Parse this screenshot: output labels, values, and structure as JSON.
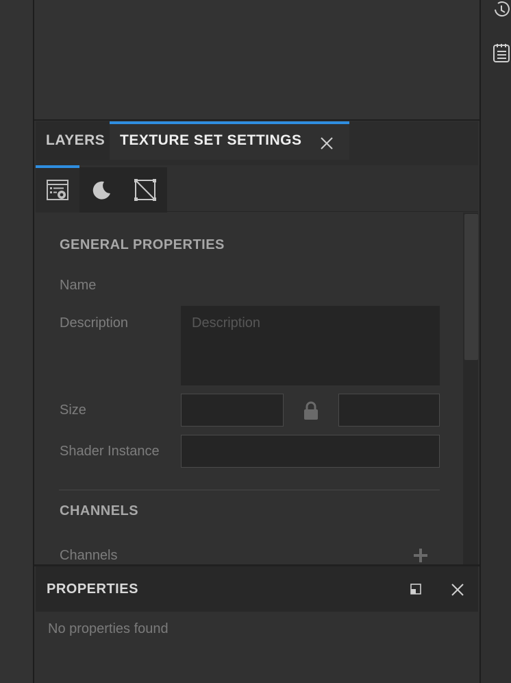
{
  "tabs": {
    "layers_label": "LAYERS",
    "active_label": "TEXTURE SET SETTINGS"
  },
  "subtabs": [
    {
      "icon": "texture-settings-icon"
    },
    {
      "icon": "moon-icon"
    },
    {
      "icon": "uv-square-icon"
    }
  ],
  "general": {
    "title": "GENERAL PROPERTIES",
    "name_label": "Name",
    "description_label": "Description",
    "description_placeholder": "Description",
    "size_label": "Size",
    "shader_label": "Shader Instance"
  },
  "channels": {
    "title": "CHANNELS",
    "channels_label": "Channels"
  },
  "properties": {
    "title": "PROPERTIES",
    "empty_text": "No properties found"
  },
  "colors": {
    "accent": "#2f8ee0",
    "panel_bg": "#313131",
    "field_bg": "#252525"
  }
}
